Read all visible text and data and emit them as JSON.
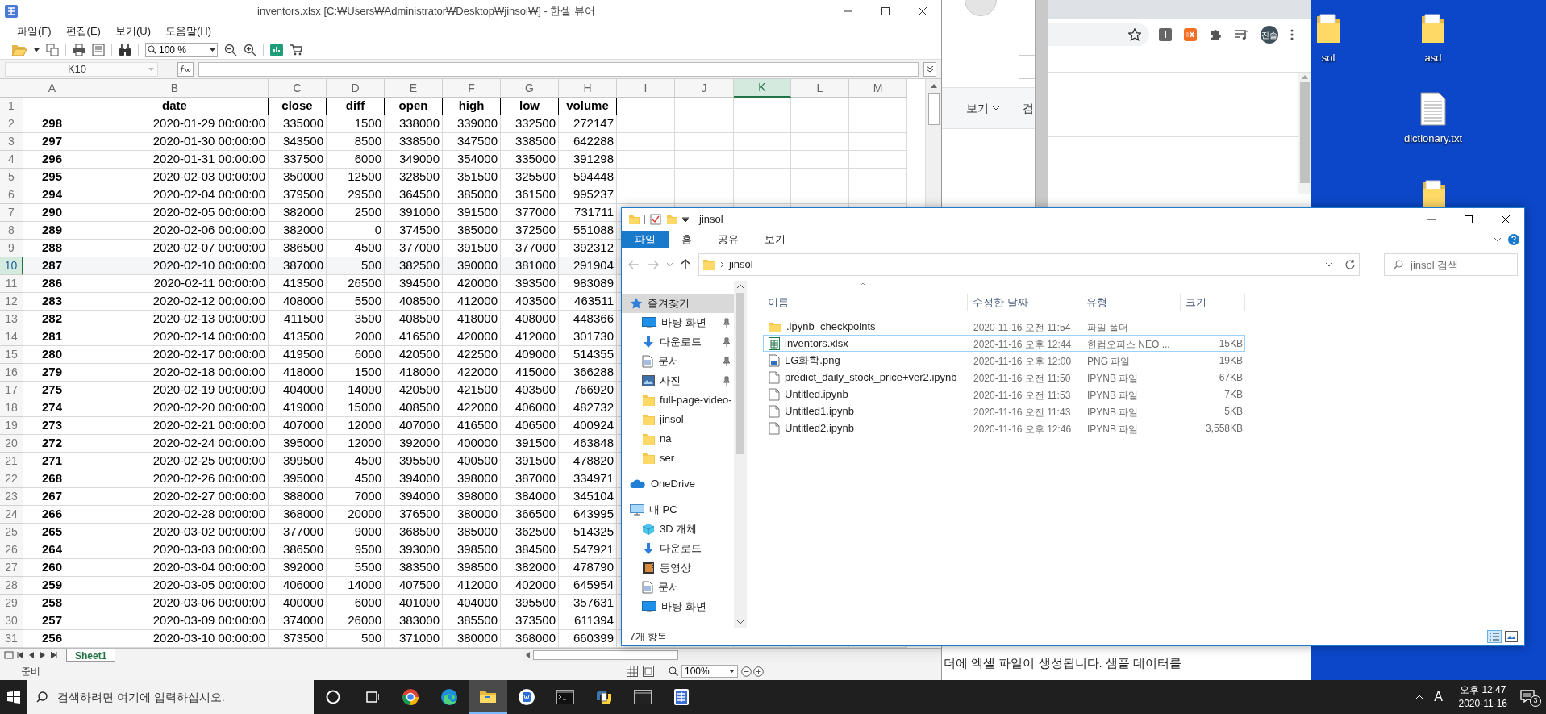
{
  "spreadsheet": {
    "title": "inventors.xlsx [C:₩Users₩Administrator₩Desktop₩jinsol₩] - 한셀 뷰어",
    "menu": [
      "파일(F)",
      "편집(E)",
      "보기(U)",
      "도움말(H)"
    ],
    "zoom": "100 %",
    "name_box": "K10",
    "columns": [
      {
        "label": "A",
        "selected": false
      },
      {
        "label": "B",
        "selected": false
      },
      {
        "label": "C",
        "selected": false
      },
      {
        "label": "D",
        "selected": false
      },
      {
        "label": "E",
        "selected": false
      },
      {
        "label": "F",
        "selected": false
      },
      {
        "label": "G",
        "selected": false
      },
      {
        "label": "H",
        "selected": false
      },
      {
        "label": "I",
        "selected": false
      },
      {
        "label": "J",
        "selected": false
      },
      {
        "label": "K",
        "selected": true
      },
      {
        "label": "L",
        "selected": false
      },
      {
        "label": "M",
        "selected": false
      }
    ],
    "header_row": {
      "number": "1",
      "cells": [
        "date",
        "close",
        "diff",
        "open",
        "high",
        "low",
        "volume"
      ]
    },
    "rows": [
      {
        "number": "2",
        "selected": false,
        "cells": [
          "298",
          "2020-01-29 00:00:00",
          "335000",
          "1500",
          "338000",
          "339000",
          "332500",
          "272147"
        ]
      },
      {
        "number": "3",
        "selected": false,
        "cells": [
          "297",
          "2020-01-30 00:00:00",
          "343500",
          "8500",
          "338500",
          "347500",
          "338500",
          "642288"
        ]
      },
      {
        "number": "4",
        "selected": false,
        "cells": [
          "296",
          "2020-01-31 00:00:00",
          "337500",
          "6000",
          "349000",
          "354000",
          "335000",
          "391298"
        ]
      },
      {
        "number": "5",
        "selected": false,
        "cells": [
          "295",
          "2020-02-03 00:00:00",
          "350000",
          "12500",
          "328500",
          "351500",
          "325500",
          "594448"
        ]
      },
      {
        "number": "6",
        "selected": false,
        "cells": [
          "294",
          "2020-02-04 00:00:00",
          "379500",
          "29500",
          "364500",
          "385000",
          "361500",
          "995237"
        ]
      },
      {
        "number": "7",
        "selected": false,
        "cells": [
          "290",
          "2020-02-05 00:00:00",
          "382000",
          "2500",
          "391000",
          "391500",
          "377000",
          "731711"
        ]
      },
      {
        "number": "8",
        "selected": false,
        "cells": [
          "289",
          "2020-02-06 00:00:00",
          "382000",
          "0",
          "374500",
          "385000",
          "372500",
          "551088"
        ]
      },
      {
        "number": "9",
        "selected": false,
        "cells": [
          "288",
          "2020-02-07 00:00:00",
          "386500",
          "4500",
          "377000",
          "391500",
          "377000",
          "392312"
        ]
      },
      {
        "number": "10",
        "selected": true,
        "cells": [
          "287",
          "2020-02-10 00:00:00",
          "387000",
          "500",
          "382500",
          "390000",
          "381000",
          "291904"
        ]
      },
      {
        "number": "11",
        "selected": false,
        "cells": [
          "286",
          "2020-02-11 00:00:00",
          "413500",
          "26500",
          "394500",
          "420000",
          "393500",
          "983089"
        ]
      },
      {
        "number": "12",
        "selected": false,
        "cells": [
          "283",
          "2020-02-12 00:00:00",
          "408000",
          "5500",
          "408500",
          "412000",
          "403500",
          "463511"
        ]
      },
      {
        "number": "13",
        "selected": false,
        "cells": [
          "282",
          "2020-02-13 00:00:00",
          "411500",
          "3500",
          "408500",
          "418000",
          "408000",
          "448366"
        ]
      },
      {
        "number": "14",
        "selected": false,
        "cells": [
          "281",
          "2020-02-14 00:00:00",
          "413500",
          "2000",
          "416500",
          "420000",
          "412000",
          "301730"
        ]
      },
      {
        "number": "15",
        "selected": false,
        "cells": [
          "280",
          "2020-02-17 00:00:00",
          "419500",
          "6000",
          "420500",
          "422500",
          "409000",
          "514355"
        ]
      },
      {
        "number": "16",
        "selected": false,
        "cells": [
          "279",
          "2020-02-18 00:00:00",
          "418000",
          "1500",
          "418000",
          "422000",
          "415000",
          "366288"
        ]
      },
      {
        "number": "17",
        "selected": false,
        "cells": [
          "275",
          "2020-02-19 00:00:00",
          "404000",
          "14000",
          "420500",
          "421500",
          "403500",
          "766920"
        ]
      },
      {
        "number": "18",
        "selected": false,
        "cells": [
          "274",
          "2020-02-20 00:00:00",
          "419000",
          "15000",
          "408500",
          "422000",
          "406000",
          "482732"
        ]
      },
      {
        "number": "19",
        "selected": false,
        "cells": [
          "273",
          "2020-02-21 00:00:00",
          "407000",
          "12000",
          "407000",
          "416500",
          "406500",
          "400924"
        ]
      },
      {
        "number": "20",
        "selected": false,
        "cells": [
          "272",
          "2020-02-24 00:00:00",
          "395000",
          "12000",
          "392000",
          "400000",
          "391500",
          "463848"
        ]
      },
      {
        "number": "21",
        "selected": false,
        "cells": [
          "271",
          "2020-02-25 00:00:00",
          "399500",
          "4500",
          "395500",
          "400500",
          "391500",
          "478820"
        ]
      },
      {
        "number": "22",
        "selected": false,
        "cells": [
          "268",
          "2020-02-26 00:00:00",
          "395000",
          "4500",
          "394000",
          "398000",
          "387000",
          "334971"
        ]
      },
      {
        "number": "23",
        "selected": false,
        "cells": [
          "267",
          "2020-02-27 00:00:00",
          "388000",
          "7000",
          "394000",
          "398000",
          "384000",
          "345104"
        ]
      },
      {
        "number": "24",
        "selected": false,
        "cells": [
          "266",
          "2020-02-28 00:00:00",
          "368000",
          "20000",
          "376500",
          "380000",
          "366500",
          "643995"
        ]
      },
      {
        "number": "25",
        "selected": false,
        "cells": [
          "265",
          "2020-03-02 00:00:00",
          "377000",
          "9000",
          "368500",
          "385000",
          "362500",
          "514325"
        ]
      },
      {
        "number": "26",
        "selected": false,
        "cells": [
          "264",
          "2020-03-03 00:00:00",
          "386500",
          "9500",
          "393000",
          "398500",
          "384500",
          "547921"
        ]
      },
      {
        "number": "27",
        "selected": false,
        "cells": [
          "260",
          "2020-03-04 00:00:00",
          "392000",
          "5500",
          "383500",
          "398500",
          "382000",
          "478790"
        ]
      },
      {
        "number": "28",
        "selected": false,
        "cells": [
          "259",
          "2020-03-05 00:00:00",
          "406000",
          "14000",
          "407500",
          "412000",
          "402000",
          "645954"
        ]
      },
      {
        "number": "29",
        "selected": false,
        "cells": [
          "258",
          "2020-03-06 00:00:00",
          "400000",
          "6000",
          "401000",
          "404000",
          "395500",
          "357631"
        ]
      },
      {
        "number": "30",
        "selected": false,
        "cells": [
          "257",
          "2020-03-09 00:00:00",
          "374000",
          "26000",
          "383000",
          "385500",
          "373500",
          "611394"
        ]
      },
      {
        "number": "31",
        "selected": false,
        "cells": [
          "256",
          "2020-03-10 00:00:00",
          "373500",
          "500",
          "371000",
          "380000",
          "368000",
          "660399"
        ]
      }
    ],
    "sheet_tabs": [
      {
        "label": "Sheet1",
        "selected": true
      }
    ],
    "status": "준비",
    "status_zoom": "100%"
  },
  "browser": {
    "tab_labels": [
      "보기",
      "검"
    ],
    "avatar": "진솔",
    "page_text": "더에 엑셀 파일이 생성됩니다. 샘플 데이터를"
  },
  "explorer": {
    "title": "jinsol",
    "ribbon_tabs": [
      {
        "label": "파일",
        "selected": true
      },
      {
        "label": "홈",
        "selected": false
      },
      {
        "label": "공유",
        "selected": false
      },
      {
        "label": "보기",
        "selected": false
      }
    ],
    "address": "jinsol",
    "search": {
      "placeholder": "jinsol 검색"
    },
    "nav": [
      {
        "label": "즐겨찾기",
        "kind": "star",
        "selected": true,
        "pinned": false,
        "children": [
          {
            "label": "바탕 화면",
            "kind": "desktop",
            "selected": false,
            "pinned": true
          },
          {
            "label": "다운로드",
            "kind": "download",
            "selected": false,
            "pinned": true
          },
          {
            "label": "문서",
            "kind": "document",
            "selected": false,
            "pinned": true
          },
          {
            "label": "사진",
            "kind": "picture",
            "selected": false,
            "pinned": true
          },
          {
            "label": "full-page-video-",
            "kind": "folder",
            "selected": false,
            "pinned": false
          },
          {
            "label": "jinsol",
            "kind": "folder",
            "selected": false,
            "pinned": false
          },
          {
            "label": "na",
            "kind": "folder",
            "selected": false,
            "pinned": false
          },
          {
            "label": "ser",
            "kind": "folder",
            "selected": false,
            "pinned": false
          }
        ]
      },
      {
        "label": "OneDrive",
        "kind": "cloud",
        "selected": false,
        "pinned": false
      },
      {
        "label": "내 PC",
        "kind": "pc",
        "selected": false,
        "pinned": false,
        "children": [
          {
            "label": "3D 개체",
            "kind": "cube",
            "selected": false,
            "pinned": false
          },
          {
            "label": "다운로드",
            "kind": "download",
            "selected": false,
            "pinned": false
          },
          {
            "label": "동영상",
            "kind": "video",
            "selected": false,
            "pinned": false
          },
          {
            "label": "문서",
            "kind": "document",
            "selected": false,
            "pinned": false
          },
          {
            "label": "바탕 화면",
            "kind": "desktop",
            "selected": false,
            "pinned": false
          }
        ]
      }
    ],
    "columns": [
      "이름",
      "수정한 날짜",
      "유형",
      "크기"
    ],
    "files": [
      {
        "name": ".ipynb_checkpoints",
        "date": "2020-11-16 오전 11:54",
        "type": "파일 폴더",
        "kind": "folder",
        "selected": false
      },
      {
        "name": "inventors.xlsx",
        "date": "2020-11-16 오후 12:44",
        "type": "한컴오피스 NEO ...",
        "size": "15KB",
        "kind": "sheet",
        "selected": true
      },
      {
        "name": "LG화학.png",
        "date": "2020-11-16 오후 12:00",
        "type": "PNG 파일",
        "size": "19KB",
        "kind": "image",
        "selected": false
      },
      {
        "name": "predict_daily_stock_price+ver2.ipynb",
        "date": "2020-11-16 오전 11:50",
        "type": "IPYNB 파일",
        "size": "67KB",
        "kind": "file",
        "selected": false
      },
      {
        "name": "Untitled.ipynb",
        "date": "2020-11-16 오전 11:53",
        "type": "IPYNB 파일",
        "size": "7KB",
        "kind": "file",
        "selected": false
      },
      {
        "name": "Untitled1.ipynb",
        "date": "2020-11-16 오전 11:43",
        "type": "IPYNB 파일",
        "size": "5KB",
        "kind": "file",
        "selected": false
      },
      {
        "name": "Untitled2.ipynb",
        "date": "2020-11-16 오후 12:46",
        "type": "IPYNB 파일",
        "size": "3,558KB",
        "kind": "file",
        "selected": false
      }
    ],
    "status": "7개 항목"
  },
  "desktop_icons": [
    {
      "label": "sol",
      "kind": "folder"
    },
    {
      "label": "asd",
      "kind": "folder"
    },
    {
      "label": "dictionary.txt",
      "kind": "text"
    }
  ],
  "taskbar": {
    "search": {
      "placeholder": "검색하려면 여기에 입력하십시오."
    },
    "apps": [
      {
        "kind": "cortana",
        "active": false
      },
      {
        "kind": "taskview",
        "active": false
      },
      {
        "kind": "chrome",
        "active": false
      },
      {
        "kind": "edge",
        "active": false
      },
      {
        "kind": "explorer",
        "active": true
      },
      {
        "kind": "writer",
        "active": false
      },
      {
        "kind": "terminal",
        "active": false
      },
      {
        "kind": "python",
        "active": false
      },
      {
        "kind": "window",
        "active": false
      },
      {
        "kind": "hancell",
        "active": false
      }
    ],
    "ime": "A",
    "time": "오후 12:47",
    "date": "2020-11-16",
    "notifications": "3"
  }
}
